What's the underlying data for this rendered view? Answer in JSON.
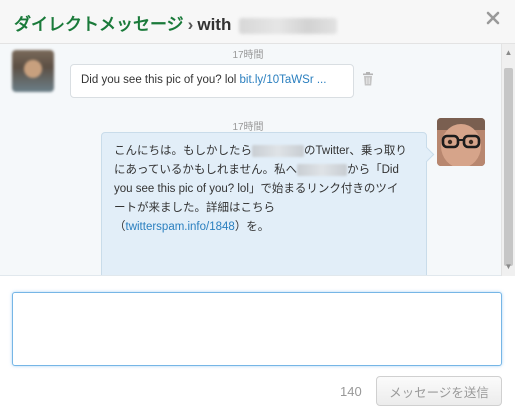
{
  "header": {
    "title": "ダイレクトメッセージ",
    "separator": "›",
    "with_label": "with",
    "close_icon": "close-icon"
  },
  "messages": [
    {
      "time": "17時間",
      "text_prefix": "Did you see this pic of you? lol ",
      "link_text": "bit.ly/10TaWSr ...",
      "delete_icon": "trash-icon"
    },
    {
      "time": "17時間",
      "line1_a": "こんにちは。もしかしたら",
      "line1_b": "のTwitter、乗っ取り",
      "line2": "にあっているかもしれません。私へ",
      "line2_b": "から「Did",
      "line3": "you see this pic of you? lol」で始まるリンク付きのツイ",
      "line4": "ートが来ました。詳細はこちら",
      "line5_open": "（",
      "line5_link": "twitterspam.info/1848",
      "line5_close": "）を。"
    }
  ],
  "compose": {
    "placeholder": "",
    "char_count": "140",
    "send_label": "メッセージを送信"
  },
  "colors": {
    "title_green": "#1a7a3a",
    "link_blue": "#2a7fbf",
    "sent_bubble": "#e2eef8"
  }
}
